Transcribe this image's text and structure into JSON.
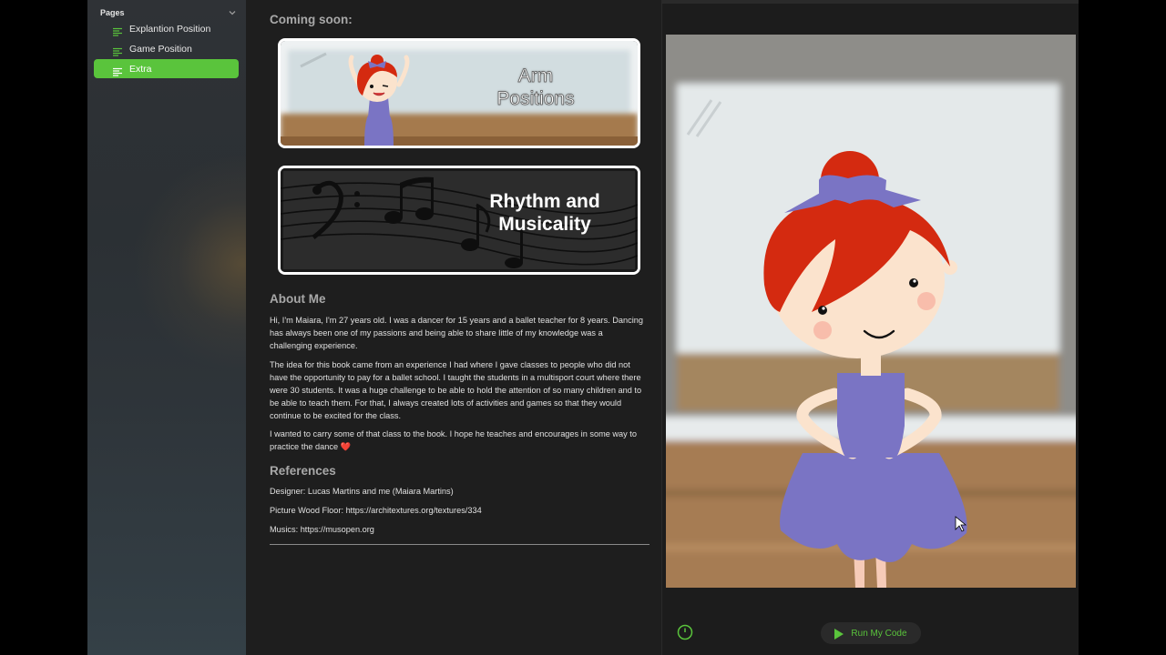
{
  "sidebar": {
    "title": "Pages",
    "items": [
      {
        "label": "Explantion Position",
        "active": false
      },
      {
        "label": "Game Position",
        "active": false
      },
      {
        "label": "Extra",
        "active": true
      }
    ]
  },
  "main": {
    "coming_soon": "Coming soon:",
    "banners": [
      {
        "line1": "Arm",
        "line2": "Positions"
      },
      {
        "line1": "Rhythm and",
        "line2": "Musicality"
      }
    ],
    "about": {
      "title": "About Me",
      "paragraphs": [
        "Hi, I'm Maiara, I'm 27 years old. I was a dancer for 15 years and a ballet teacher for 8 years. Dancing has always been one of my passions and being able to share little of my knowledge was a challenging experience.",
        "The idea for this book came from an experience I had where I gave classes to people who did not have the opportunity to pay for a ballet school. I taught the students in a multisport court where there were 30 students. It was a huge challenge to be able to hold the attention of so many children and to be able to teach them. For that, I always created lots of activities and games so that they would continue to be excited for the class.",
        "I wanted to carry some of that class to the book. I hope he teaches and encourages in some way to practice the dance ❤️"
      ]
    },
    "references": {
      "title": "References",
      "items": [
        "Designer: Lucas Martins and me (Maiara Martins)",
        "Picture Wood Floor: https://architextures.org/textures/334",
        "Musics:  https://musopen.org"
      ]
    }
  },
  "preview": {
    "run_label": "Run My Code"
  },
  "colors": {
    "accent": "#5ac43c",
    "dress": "#7a74c4",
    "hair": "#d42a10",
    "skin": "#fbe3cd"
  }
}
